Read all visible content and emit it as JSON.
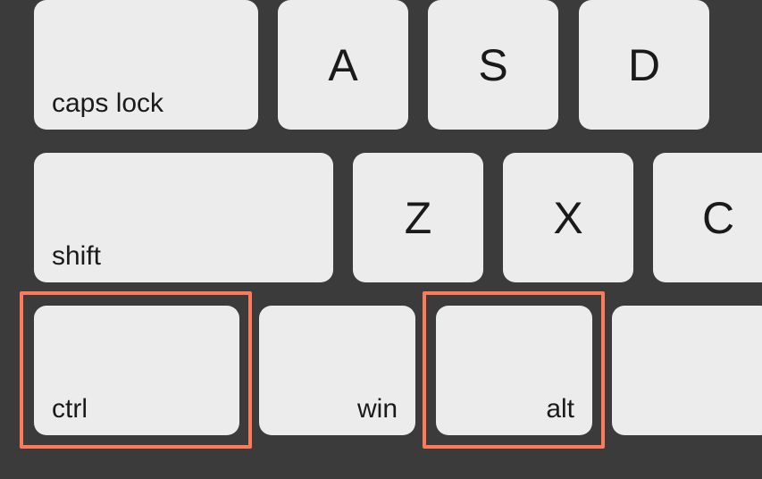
{
  "keys": {
    "capslock": "caps lock",
    "a": "A",
    "s": "S",
    "d": "D",
    "shift": "shift",
    "z": "Z",
    "x": "X",
    "c": "C",
    "ctrl": "ctrl",
    "win": "win",
    "alt": "alt"
  },
  "highlights": [
    "ctrl",
    "alt"
  ],
  "colors": {
    "background": "#3b3b3b",
    "key": "#ececec",
    "highlight": "#ff7a59"
  }
}
